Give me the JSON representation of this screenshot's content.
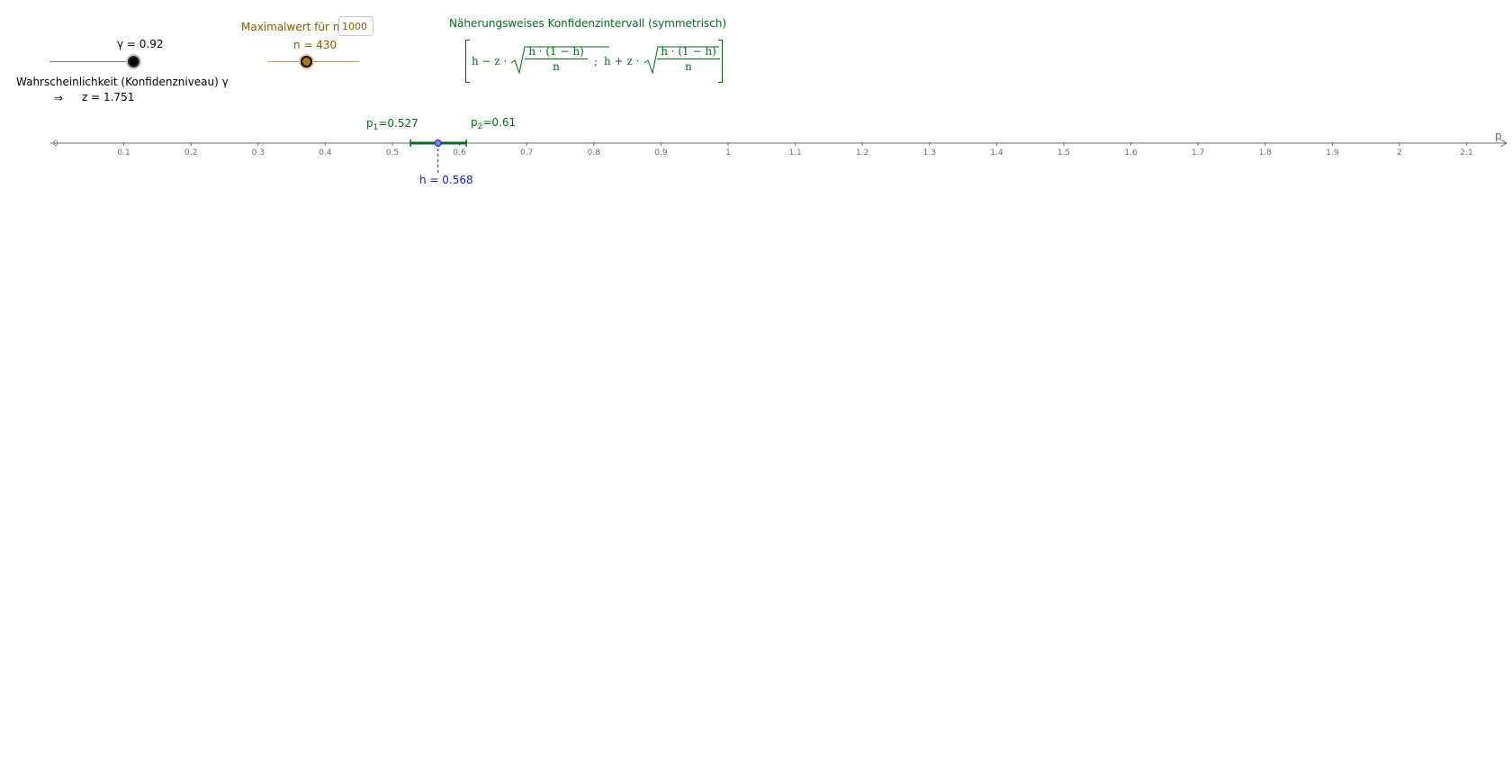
{
  "gamma_slider": {
    "label": "γ = 0.92",
    "value": 0.92
  },
  "prob_label": "Wahrscheinlichkeit (Konfidenzniveau) γ",
  "implies": "⇒",
  "z_label": "z = 1.751",
  "max_n": {
    "label": "Maximalwert für n:",
    "value": "1000"
  },
  "n_slider": {
    "label": "n = 430",
    "value": 430,
    "max": 1000
  },
  "formula": {
    "title": "Näherungsweises Konfidenzintervall (symmetrisch)",
    "left_term": "h − z ·",
    "right_term": "h + z ·",
    "separator": ";",
    "numerator": "h · (1 − h)",
    "denominator": "n"
  },
  "axis": {
    "var_label": "p",
    "zero_label": "0",
    "ticks": [
      "0.1",
      "0.2",
      "0.3",
      "0.4",
      "0.5",
      "0.6",
      "0.7",
      "0.8",
      "0.9",
      "1",
      "1.1",
      "1.2",
      "1.3",
      "1.4",
      "1.5",
      "1.6",
      "1.7",
      "1.8",
      "1.9",
      "2",
      "2.1"
    ]
  },
  "interval": {
    "p1": 0.527,
    "p2": 0.61,
    "h": 0.568,
    "p1_label": {
      "sym": "p",
      "sub": "1",
      "val": "=0.527"
    },
    "p2_label": {
      "sym": "p",
      "sub": "2",
      "val": "=0.61"
    },
    "h_label": "h = 0.568"
  },
  "colors": {
    "interval": "#006e19",
    "h_point": "#1a1ad6",
    "axis": "#6e6e6e"
  }
}
